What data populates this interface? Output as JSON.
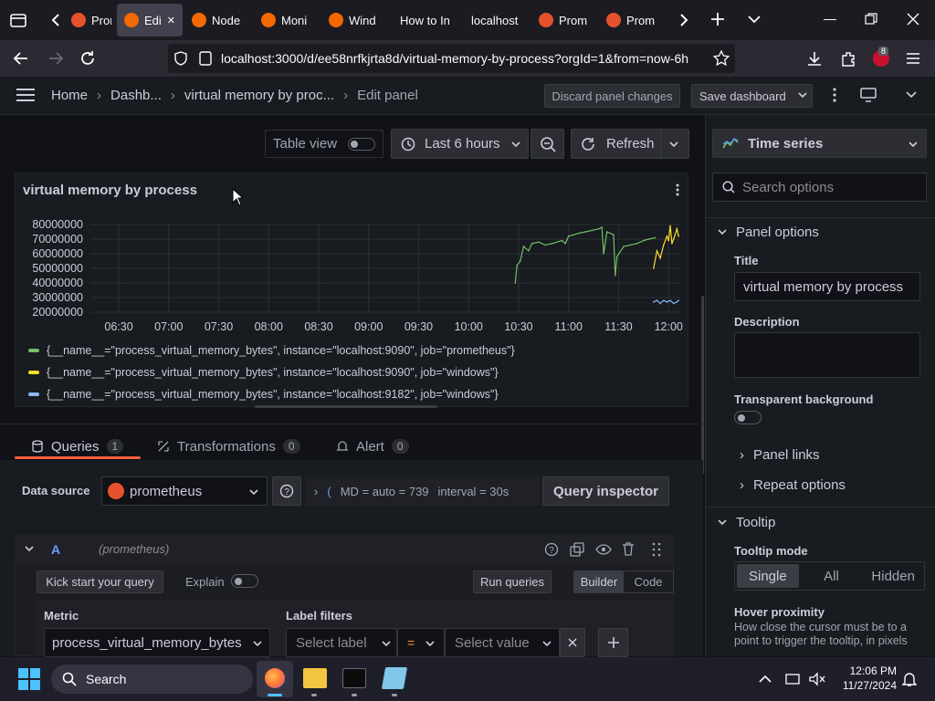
{
  "browser": {
    "tabs": [
      {
        "label": "Prom",
        "icon": "prometheus-icon",
        "color": "#e6522c"
      },
      {
        "label": "Edi",
        "icon": "grafana-icon",
        "color": "#f46800",
        "active": true
      },
      {
        "label": "Node",
        "icon": "grafana-icon",
        "color": "#f46800"
      },
      {
        "label": "Moni",
        "icon": "grafana-icon",
        "color": "#f46800"
      },
      {
        "label": "Wind",
        "icon": "grafana-icon",
        "color": "#f46800"
      },
      {
        "label": "How to In",
        "icon": "none"
      },
      {
        "label": "localhost",
        "icon": "none"
      },
      {
        "label": "Prom",
        "icon": "prometheus-icon",
        "color": "#e6522c"
      },
      {
        "label": "Prom",
        "icon": "prometheus-icon",
        "color": "#e6522c"
      }
    ],
    "url": "localhost:3000/d/ee58nrfkjrta8d/virtual-memory-by-process?orgId=1&from=now-6h",
    "extension_badge": "8"
  },
  "nav": {
    "breadcrumb": [
      "Home",
      "Dashb...",
      "virtual memory by proc...",
      "Edit panel"
    ],
    "discard_label": "Discard panel changes",
    "save_label": "Save dashboard"
  },
  "toolbar": {
    "table_view_label": "Table view",
    "time_range": "Last 6 hours",
    "refresh_label": "Refresh"
  },
  "panel": {
    "title": "virtual memory by process",
    "legend": [
      {
        "text": "{__name__=\"process_virtual_memory_bytes\", instance=\"localhost:9090\", job=\"prometheus\"}",
        "color": "#73bf69"
      },
      {
        "text": "{__name__=\"process_virtual_memory_bytes\", instance=\"localhost:9090\", job=\"windows\"}",
        "color": "#fade2a"
      },
      {
        "text": "{__name__=\"process_virtual_memory_bytes\", instance=\"localhost:9182\", job=\"windows\"}",
        "color": "#8ab8ff"
      }
    ]
  },
  "chart_data": {
    "type": "line",
    "y_ticks": [
      "80000000",
      "70000000",
      "60000000",
      "50000000",
      "40000000",
      "30000000",
      "20000000"
    ],
    "x_ticks": [
      "06:30",
      "07:00",
      "07:30",
      "08:00",
      "08:30",
      "09:00",
      "09:30",
      "10:00",
      "10:30",
      "11:00",
      "11:30",
      "12:00"
    ],
    "ylim": [
      20000000,
      80000000
    ],
    "x_range": [
      "06:13",
      "12:07"
    ],
    "series": [
      {
        "name": "{__name__=\"process_virtual_memory_bytes\", instance=\"localhost:9090\", job=\"prometheus\"}",
        "color": "#73bf69",
        "points": [
          [
            "10:28",
            40000000
          ],
          [
            "10:29",
            52000000
          ],
          [
            "10:31",
            55000000
          ],
          [
            "10:33",
            65000000
          ],
          [
            "10:36",
            62000000
          ],
          [
            "10:38",
            67000000
          ],
          [
            "10:42",
            68000000
          ],
          [
            "10:46",
            66000000
          ],
          [
            "10:50",
            67000000
          ],
          [
            "10:56",
            69000000
          ],
          [
            "10:58",
            67000000
          ],
          [
            "11:00",
            72000000
          ],
          [
            "11:03",
            73000000
          ],
          [
            "11:06",
            74000000
          ],
          [
            "11:10",
            75000000
          ],
          [
            "11:14",
            76000000
          ],
          [
            "11:18",
            77000000
          ],
          [
            "11:20",
            78000000
          ],
          [
            "11:21",
            60000000
          ],
          [
            "11:23",
            75000000
          ],
          [
            "11:27",
            73000000
          ],
          [
            "11:28",
            45000000
          ],
          [
            "11:29",
            58000000
          ],
          [
            "11:33",
            65000000
          ],
          [
            "11:37",
            66000000
          ],
          [
            "11:41",
            67000000
          ],
          [
            "11:45",
            69000000
          ],
          [
            "11:48",
            70000000
          ],
          [
            "11:52",
            71000000
          ]
        ]
      },
      {
        "name": "{__name__=\"process_virtual_memory_bytes\", instance=\"localhost:9090\", job=\"windows\"}",
        "color": "#fade2a",
        "points": [
          [
            "11:51",
            50000000
          ],
          [
            "11:53",
            62000000
          ],
          [
            "11:55",
            57000000
          ],
          [
            "11:57",
            66000000
          ],
          [
            "11:59",
            72000000
          ],
          [
            "12:00",
            69000000
          ],
          [
            "12:01",
            79000000
          ],
          [
            "12:02",
            67000000
          ],
          [
            "12:03",
            70000000
          ],
          [
            "12:05",
            77000000
          ],
          [
            "12:06",
            72000000
          ]
        ]
      },
      {
        "name": "{__name__=\"process_virtual_memory_bytes\", instance=\"localhost:9182\", job=\"windows\"}",
        "color": "#8ab8ff",
        "points": [
          [
            "11:51",
            27000000
          ],
          [
            "11:53",
            28000000
          ],
          [
            "11:55",
            26000000
          ],
          [
            "11:57",
            28000000
          ],
          [
            "11:59",
            27000000
          ],
          [
            "12:01",
            28000000
          ],
          [
            "12:03",
            26000000
          ],
          [
            "12:05",
            27000000
          ],
          [
            "12:06",
            28000000
          ]
        ]
      }
    ]
  },
  "queries": {
    "tabs": [
      {
        "label": "Queries",
        "count": "1",
        "icon": "database-icon"
      },
      {
        "label": "Transformations",
        "count": "0",
        "icon": "transform-icon"
      },
      {
        "label": "Alert",
        "count": "0",
        "icon": "bell-icon"
      }
    ],
    "data_source_label": "Data source",
    "data_source_value": "prometheus",
    "query_options_text": "MD = auto = 739",
    "interval_text": "interval = 30s",
    "inspector_label": "Query inspector",
    "query_letter": "A",
    "query_ds": "(prometheus)",
    "kickstart_label": "Kick start your query",
    "explain_label": "Explain",
    "run_label": "Run queries",
    "builder_label": "Builder",
    "code_label": "Code",
    "metric_label": "Metric",
    "metric_value": "process_virtual_memory_bytes",
    "label_filters_label": "Label filters",
    "select_label_placeholder": "Select label",
    "operator": "=",
    "select_value_placeholder": "Select value"
  },
  "options": {
    "viz_type": "Time series",
    "search_placeholder": "Search options",
    "panel_options_header": "Panel options",
    "title_label": "Title",
    "title_value": "virtual memory by process",
    "description_label": "Description",
    "transparent_label": "Transparent background",
    "panel_links_label": "Panel links",
    "repeat_options_label": "Repeat options",
    "tooltip_header": "Tooltip",
    "tooltip_mode_label": "Tooltip mode",
    "tooltip_modes": [
      "Single",
      "All",
      "Hidden"
    ],
    "hover_label": "Hover proximity",
    "hover_desc": "How close the cursor must be to a point to trigger the tooltip, in pixels"
  },
  "taskbar": {
    "search_label": "Search",
    "time": "12:06 PM",
    "date": "11/27/2024"
  }
}
